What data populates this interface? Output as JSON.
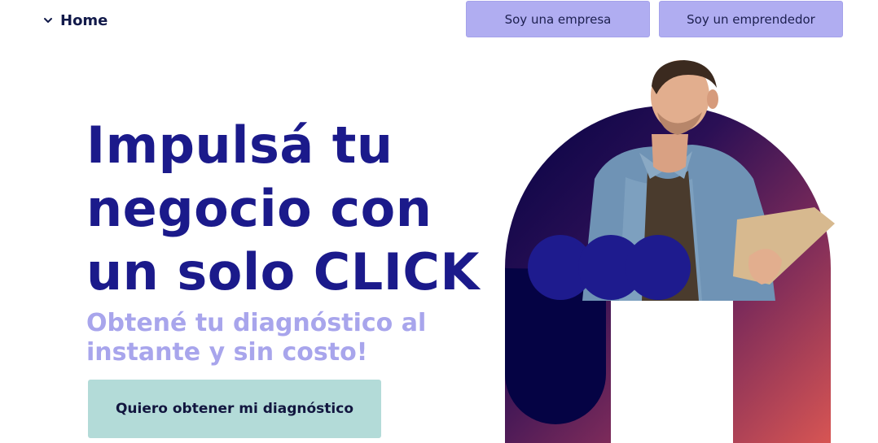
{
  "nav": {
    "home_label": "Home",
    "home_icon": "chevron-down-icon"
  },
  "header": {
    "buttons": [
      {
        "label": "Soy una empresa"
      },
      {
        "label": "Soy un emprendedor"
      }
    ]
  },
  "hero": {
    "headline_lines": [
      "Impulsá tu",
      "negocio con",
      "un solo CLICK"
    ],
    "subheadline_lines": [
      "Obtené tu diagnóstico al",
      "instante y sin costo!"
    ],
    "cta_label": "Quiero obtener mi diagnóstico"
  },
  "colors": {
    "primary": "#1b1a8b",
    "accent_lilac": "#b0adf1",
    "subhead": "#a8a5ec",
    "cta_bg": "#b3dbd8",
    "arch_dark": "#050344",
    "arch_coral": "#d75553"
  }
}
